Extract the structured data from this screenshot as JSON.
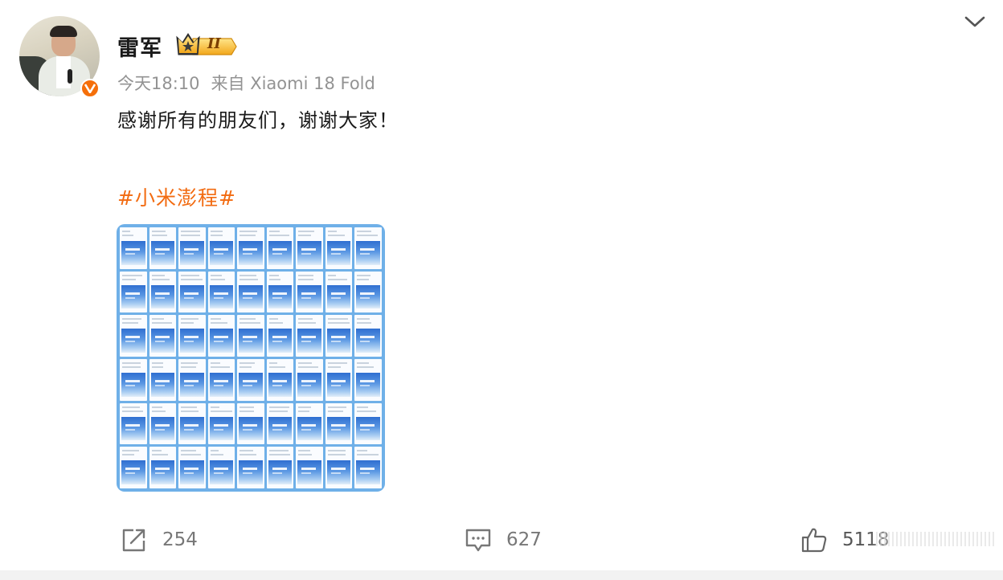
{
  "post": {
    "author": {
      "name": "雷军",
      "level_badge": "II",
      "avatar": "avatar-photo",
      "verified_badge": "verified-v-icon"
    },
    "time": "今天18:10",
    "source": "来自 Xiaomi 18 Fold",
    "text": "感谢所有的朋友们，谢谢大家！",
    "hashtag": "#小米澎程#",
    "image_grid": {
      "rows": 6,
      "cols": 9
    },
    "actions": {
      "share_count": "254",
      "comment_count": "627",
      "like_count": "5118"
    }
  },
  "colors": {
    "hashtag": "#f26b11",
    "meta_gray": "#939393",
    "verified": "#f56f0a",
    "grid_border": "#6fb0e8"
  },
  "icons": {
    "menu": "chevron-down-icon",
    "share": "share-icon",
    "comment": "comment-icon",
    "like": "thumbs-up-icon"
  }
}
